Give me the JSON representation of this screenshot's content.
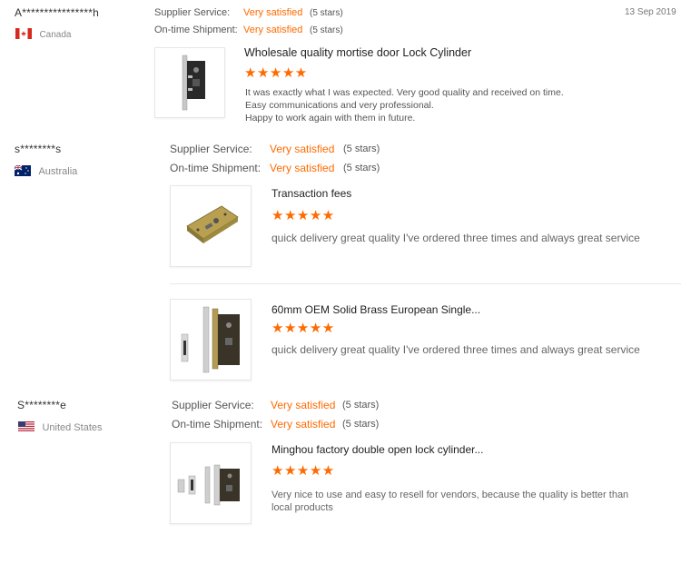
{
  "reviews": [
    {
      "buyer": "A****************h",
      "country": "Canada",
      "date": "13 Sep 2019",
      "supplier_label": "Supplier Service:",
      "supplier_rating": "Very satisfied",
      "supplier_stars": "(5 stars)",
      "shipment_label": "On-time Shipment:",
      "shipment_rating": "Very satisfied",
      "shipment_stars": "(5 stars)",
      "product_title": "Wholesale quality mortise door Lock Cylinder",
      "stars": "★★★★★",
      "text": [
        "It was exactly what I was expected. Very good quality and received on time.",
        "Easy communications and very professional.",
        "Happy to work again with them in future."
      ]
    },
    {
      "buyer": "s********s",
      "country": "Australia",
      "supplier_label": "Supplier Service:",
      "supplier_rating": "Very satisfied",
      "supplier_stars": "(5 stars)",
      "shipment_label": "On-time Shipment:",
      "shipment_rating": "Very satisfied",
      "shipment_stars": "(5 stars)",
      "products": [
        {
          "title": "Transaction fees",
          "stars": "★★★★★",
          "text": "quick delivery great quality I've ordered three times and always great service"
        },
        {
          "title": "60mm OEM Solid Brass European Single...",
          "stars": "★★★★★",
          "text": "quick delivery great quality I've ordered three times and always great service"
        }
      ]
    },
    {
      "buyer": "S********e",
      "country": "United States",
      "supplier_label": "Supplier Service:",
      "supplier_rating": "Very satisfied",
      "supplier_stars": "(5 stars)",
      "shipment_label": "On-time Shipment:",
      "shipment_rating": "Very satisfied",
      "shipment_stars": "(5 stars)",
      "product_title": "Minghou factory double open lock cylinder...",
      "stars": "★★★★★",
      "text": [
        "Very nice to use and easy to resell for vendors, because the quality is better than",
        "local products"
      ]
    }
  ],
  "colors": {
    "accent": "#ff6a00",
    "label": "#555555"
  }
}
